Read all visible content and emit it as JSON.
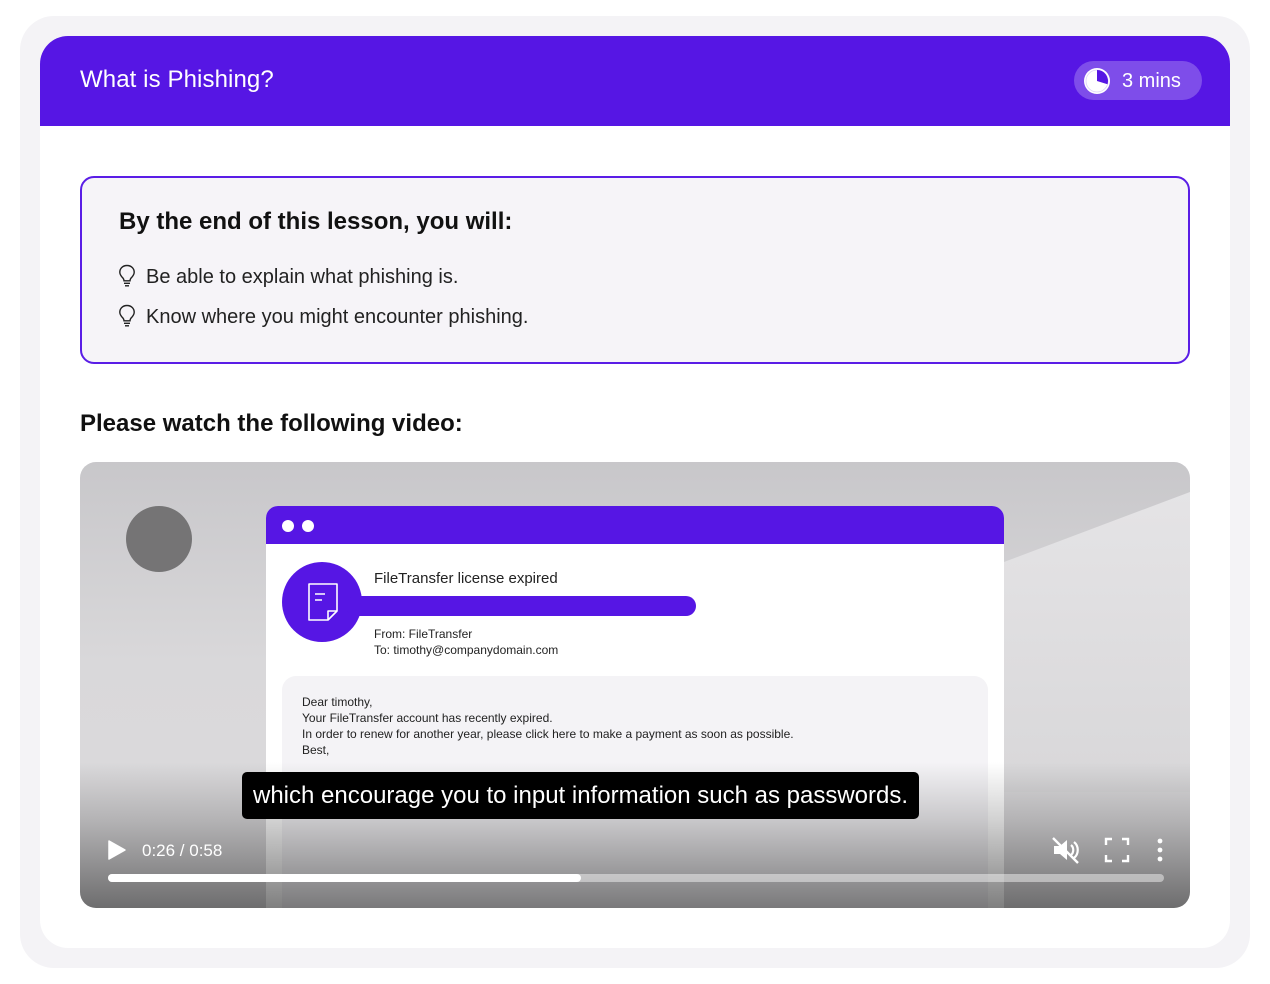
{
  "header": {
    "title": "What is Phishing?",
    "duration": "3 mins",
    "duration_icon": "clock-icon"
  },
  "objectives": {
    "heading": "By the end of this lesson, you will:",
    "items": [
      {
        "icon": "lightbulb-icon",
        "text": "Be able to explain what phishing is."
      },
      {
        "icon": "lightbulb-icon",
        "text": "Know where you might encounter phishing."
      }
    ]
  },
  "video_prompt": "Please watch the following video:",
  "video": {
    "email": {
      "subject": "FileTransfer license expired",
      "from": "From: FileTransfer",
      "to": "To: timothy@companydomain.com",
      "body_lines": [
        "Dear timothy,",
        "Your FileTransfer account has recently expired.",
        "In order to renew for another year, please click here to make a payment as soon as possible.",
        "Best,"
      ]
    },
    "caption": "which encourage you to input information such as passwords.",
    "time": "0:26 / 0:58",
    "progress_fraction": 0.448,
    "controls": {
      "play_icon": "play-icon",
      "mute_icon": "muted-speaker-icon",
      "fullscreen_icon": "fullscreen-icon",
      "more_icon": "more-vertical-icon"
    }
  },
  "colors": {
    "brand": "#5616e4",
    "objectives_border": "#5a1de6",
    "objectives_bg": "#f6f4f8"
  }
}
